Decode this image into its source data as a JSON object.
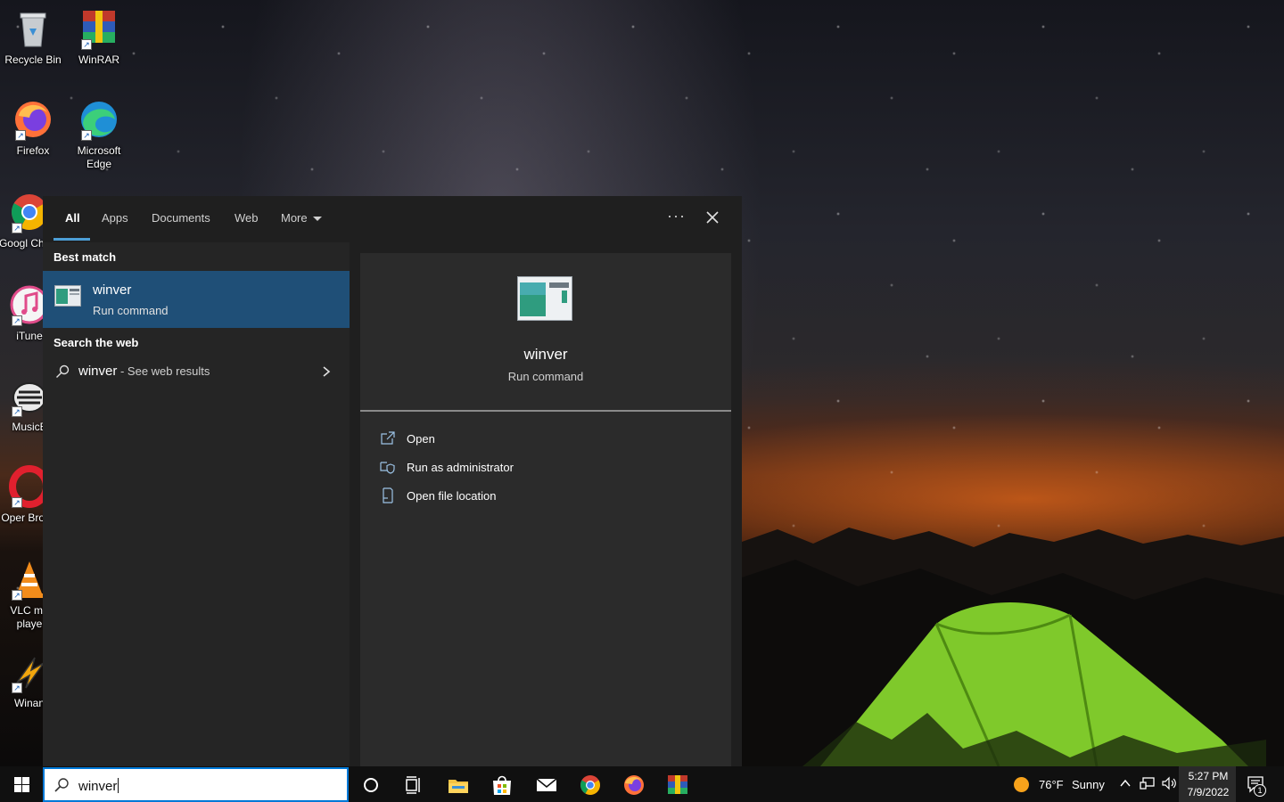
{
  "desktop": {
    "icons": [
      {
        "label": "Recycle Bin",
        "icon": "recycle-bin-icon"
      },
      {
        "label": "WinRAR",
        "icon": "winrar-icon"
      },
      {
        "label": "Firefox",
        "icon": "firefox-icon"
      },
      {
        "label": "Microsoft Edge",
        "icon": "edge-icon"
      },
      {
        "label": "Googl Chron",
        "icon": "chrome-icon"
      },
      {
        "label": "iTune",
        "icon": "itunes-icon"
      },
      {
        "label": "MusicE",
        "icon": "musicbee-icon"
      },
      {
        "label": "Oper Brows",
        "icon": "opera-icon"
      },
      {
        "label": "VLC me playe",
        "icon": "vlc-icon"
      },
      {
        "label": "Winan",
        "icon": "winamp-icon"
      }
    ]
  },
  "search_panel": {
    "tabs": [
      {
        "label": "All",
        "active": true
      },
      {
        "label": "Apps"
      },
      {
        "label": "Documents"
      },
      {
        "label": "Web"
      },
      {
        "label": "More"
      }
    ],
    "more_options": "···",
    "best_match_header": "Best match",
    "best_match": {
      "title": "winver",
      "subtitle": "Run command",
      "icon": "run-command-icon"
    },
    "web_header": "Search the web",
    "web_result": {
      "query": "winver",
      "suffix": " - See web results"
    },
    "preview": {
      "title": "winver",
      "subtitle": "Run command",
      "actions": [
        {
          "label": "Open",
          "icon": "open-icon"
        },
        {
          "label": "Run as administrator",
          "icon": "shield-icon"
        },
        {
          "label": "Open file location",
          "icon": "file-location-icon"
        }
      ]
    }
  },
  "taskbar": {
    "search_value": "winver",
    "pinned": [
      "cortana-icon",
      "task-view-icon",
      "file-explorer-icon",
      "store-icon",
      "mail-icon",
      "chrome-icon",
      "firefox-icon",
      "winrar-icon"
    ],
    "weather": {
      "temp": "76°F",
      "condition": "Sunny"
    },
    "time": "5:27 PM",
    "date": "7/9/2022",
    "notification_count": "1"
  },
  "colors": {
    "accent": "#4c9fd6",
    "selection": "#1f4f77",
    "search_border": "#0078d7"
  }
}
